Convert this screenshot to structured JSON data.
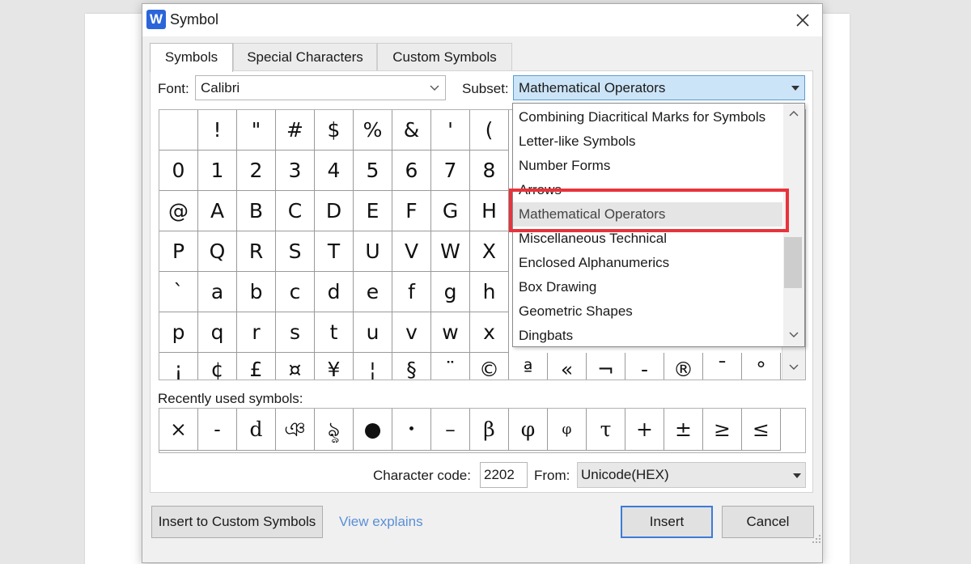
{
  "dialog": {
    "title": "Symbol",
    "app_icon_letter": "W",
    "tabs": [
      {
        "label": "Symbols",
        "active": true
      },
      {
        "label": "Special Characters",
        "active": false
      },
      {
        "label": "Custom Symbols",
        "active": false
      }
    ]
  },
  "font": {
    "label": "Font:",
    "value": "Calibri"
  },
  "subset": {
    "label": "Subset:",
    "value": "Mathematical Operators"
  },
  "subset_dropdown": {
    "items": [
      "Combining Diacritical Marks for Symbols",
      "Letter-like Symbols",
      "Number Forms",
      "Arrows",
      "Mathematical Operators",
      "Miscellaneous Technical",
      "Enclosed Alphanumerics",
      "Box Drawing",
      "Geometric Shapes",
      "Dingbats"
    ],
    "selected_index": 4
  },
  "symbol_grid": {
    "rows": [
      [
        " ",
        "!",
        "\"",
        "#",
        "$",
        "%",
        "&",
        "'",
        "("
      ],
      [
        "0",
        "1",
        "2",
        "3",
        "4",
        "5",
        "6",
        "7",
        "8"
      ],
      [
        "@",
        "A",
        "B",
        "C",
        "D",
        "E",
        "F",
        "G",
        "H"
      ],
      [
        "P",
        "Q",
        "R",
        "S",
        "T",
        "U",
        "V",
        "W",
        "X"
      ],
      [
        "`",
        "a",
        "b",
        "c",
        "d",
        "e",
        "f",
        "g",
        "h"
      ],
      [
        "p",
        "q",
        "r",
        "s",
        "t",
        "u",
        "v",
        "w",
        "x"
      ],
      [
        "¡",
        "¢",
        "£",
        "¤",
        "¥",
        "¦",
        "§",
        "¨",
        "©",
        "ª",
        "«",
        "¬",
        "-",
        "®",
        "¯",
        "°"
      ]
    ]
  },
  "recent": {
    "label": "Recently used symbols:",
    "symbols": [
      "×",
      "-",
      "d",
      "ঞ",
      "ৡ",
      "●",
      "•",
      "–",
      "β",
      "φ",
      "φ",
      "τ",
      "+",
      "±",
      "≥",
      "≤"
    ]
  },
  "character_code": {
    "label": "Character code:",
    "value": "2202"
  },
  "from": {
    "label": "From:",
    "value": "Unicode(HEX)"
  },
  "buttons": {
    "insert_custom": "Insert to Custom Symbols",
    "view_explains": "View explains",
    "insert": "Insert",
    "cancel": "Cancel"
  },
  "colors": {
    "accent": "#3d7bd9",
    "highlight": "#e8333b",
    "link": "#5a8fd6"
  }
}
